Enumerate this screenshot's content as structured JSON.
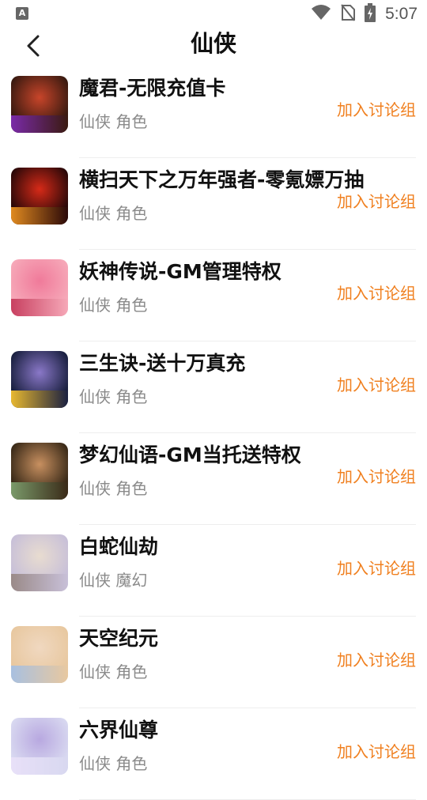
{
  "status_bar": {
    "time": "5:07",
    "left_icon": "A"
  },
  "header": {
    "title": "仙侠"
  },
  "list": [
    {
      "title": "魔君-无限充值卡",
      "tags": "仙侠 角色",
      "action": "加入讨论组",
      "colors": [
        "#3a1a10",
        "#c8452a",
        "#7a2aa8"
      ]
    },
    {
      "title": "横扫天下之万年强者-零氪嫖万抽",
      "tags": "仙侠 角色",
      "action": "加入讨论组",
      "colors": [
        "#2a0808",
        "#d62a18",
        "#e08a20"
      ]
    },
    {
      "title": "妖神传说-GM管理特权",
      "tags": "仙侠 角色",
      "action": "加入讨论组",
      "colors": [
        "#f6a8b8",
        "#f07a9a",
        "#c84060"
      ]
    },
    {
      "title": "三生诀-送十万真充",
      "tags": "仙侠 角色",
      "action": "加入讨论组",
      "colors": [
        "#1a2040",
        "#8a78c8",
        "#e8b830"
      ]
    },
    {
      "title": "梦幻仙语-GM当托送特权",
      "tags": "仙侠 角色",
      "action": "加入讨论组",
      "colors": [
        "#3a2a18",
        "#c89060",
        "#7a9a6a"
      ]
    },
    {
      "title": "白蛇仙劫",
      "tags": "仙侠 魔幻",
      "action": "加入讨论组",
      "colors": [
        "#c8c0d8",
        "#e8dcd0",
        "#9a8a88"
      ]
    },
    {
      "title": "天空纪元",
      "tags": "仙侠 角色",
      "action": "加入讨论组",
      "colors": [
        "#e8c8a0",
        "#f0d8c0",
        "#a8c0e0"
      ]
    },
    {
      "title": "六界仙尊",
      "tags": "仙侠 角色",
      "action": "加入讨论组",
      "colors": [
        "#d8d8f0",
        "#b8a8e0",
        "#e8e0f8"
      ]
    }
  ]
}
